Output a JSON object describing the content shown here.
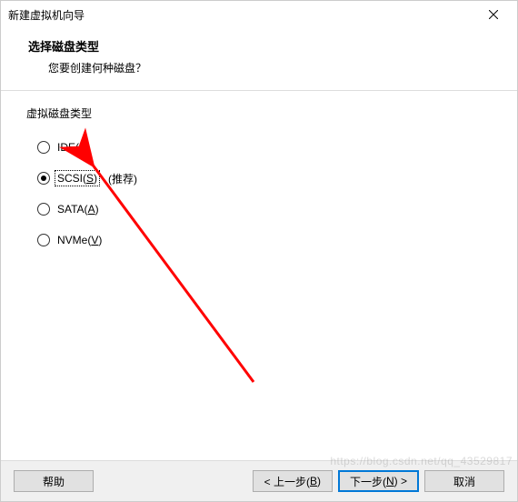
{
  "window": {
    "title": "新建虚拟机向导",
    "close_name": "close"
  },
  "header": {
    "headline": "选择磁盘类型",
    "subhead": "您要创建何种磁盘？"
  },
  "content": {
    "group_label": "虚拟磁盘类型",
    "options": [
      {
        "label_pre": "IDE(",
        "mnemo": "I",
        "label_post": ")",
        "hint": "",
        "selected": false,
        "focused": false
      },
      {
        "label_pre": "SCSI(",
        "mnemo": "S",
        "label_post": ")",
        "hint": "(推荐)",
        "selected": true,
        "focused": true
      },
      {
        "label_pre": "SATA(",
        "mnemo": "A",
        "label_post": ")",
        "hint": "",
        "selected": false,
        "focused": false
      },
      {
        "label_pre": "NVMe(",
        "mnemo": "V",
        "label_post": ")",
        "hint": "",
        "selected": false,
        "focused": false
      }
    ]
  },
  "footer": {
    "help": "帮助",
    "back_pre": "< 上一步(",
    "back_mnemo": "B",
    "back_post": ")",
    "next_pre": "下一步(",
    "next_mnemo": "N",
    "next_post": ") >",
    "cancel": "取消"
  },
  "watermark": "https://blog.csdn.net/qq_43529817"
}
